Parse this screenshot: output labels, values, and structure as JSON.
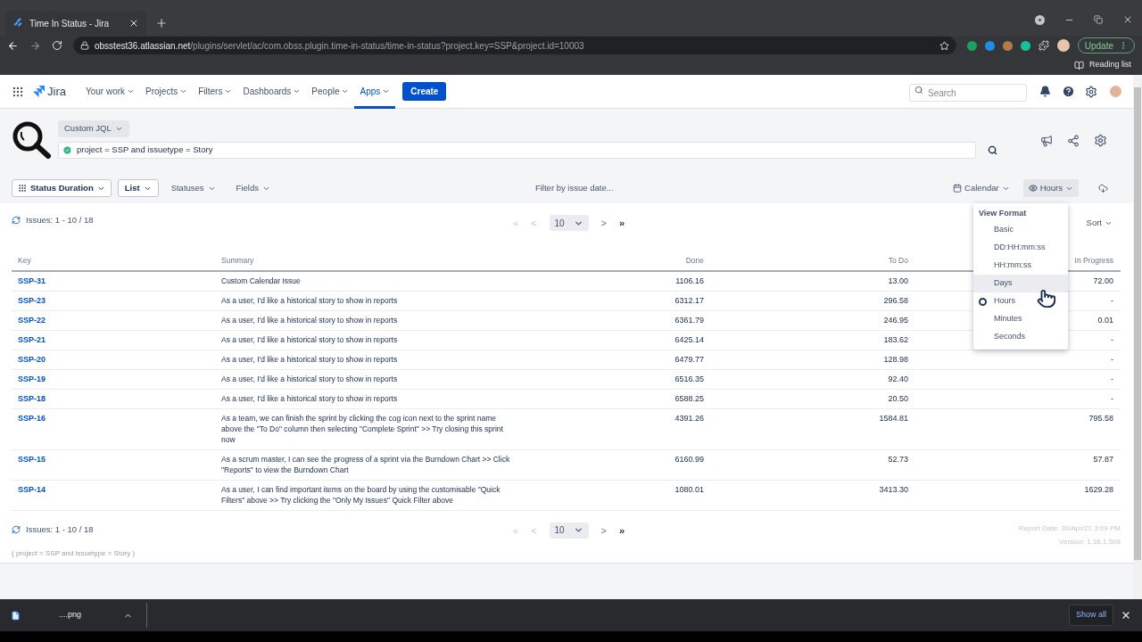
{
  "browser": {
    "tab_title": "Time In Status - Jira",
    "url_host": "obsstest36.atlassian.net",
    "url_path": "/plugins/servlet/ac/com.obss.plugin.time-in-status/time-in-status?project.key=SSP&project.id=10003",
    "update_label": "Update",
    "reading_list": "Reading list"
  },
  "nav": {
    "product": "Jira",
    "items": [
      {
        "label": "Your work",
        "selected": false
      },
      {
        "label": "Projects",
        "selected": false
      },
      {
        "label": "Filters",
        "selected": false
      },
      {
        "label": "Dashboards",
        "selected": false
      },
      {
        "label": "People",
        "selected": false
      },
      {
        "label": "Apps",
        "selected": true
      }
    ],
    "create": "Create",
    "search_placeholder": "Search"
  },
  "query": {
    "mode": "Custom JQL",
    "jql": "project = SSP and issuetype = Story",
    "valid": true
  },
  "toolbar": {
    "report": "Status Duration",
    "view": "List",
    "statuses": "Statuses",
    "fields": "Fields",
    "date_filter": "Filter by issue date...",
    "calendar": "Calendar",
    "format": "Hours"
  },
  "view_format_menu": {
    "title": "View Format",
    "options": [
      {
        "label": "Basic",
        "selected": false,
        "highlighted": false
      },
      {
        "label": "DD:HH:mm:ss",
        "selected": false,
        "highlighted": false
      },
      {
        "label": "HH:mm:ss",
        "selected": false,
        "highlighted": false
      },
      {
        "label": "Days",
        "selected": false,
        "highlighted": true
      },
      {
        "label": "Hours",
        "selected": true,
        "highlighted": false
      },
      {
        "label": "Minutes",
        "selected": false,
        "highlighted": false
      },
      {
        "label": "Seconds",
        "selected": false,
        "highlighted": false
      }
    ]
  },
  "top_bar": {
    "issues": "Issues: 1 - 10 / 18",
    "pager": [
      {
        "label": "«",
        "disabled": true
      },
      {
        "label": "<",
        "disabled": true
      },
      {
        "label": "10",
        "kind": "size"
      },
      {
        "label": ">",
        "disabled": false
      },
      {
        "label": "»",
        "disabled": false
      }
    ],
    "sort": "Sort"
  },
  "table": {
    "columns": [
      "Key",
      "Summary",
      "Done",
      "To Do",
      "In Progress"
    ],
    "rows": [
      {
        "key": "SSP-31",
        "summary": "Custom Calendar Issue",
        "done": "1106.16",
        "to_do": "13.00",
        "in_progress": "72.00"
      },
      {
        "key": "SSP-23",
        "summary": "As a user, I'd like a historical story to show in reports",
        "done": "6312.17",
        "to_do": "296.58",
        "in_progress": "-"
      },
      {
        "key": "SSP-22",
        "summary": "As a user, I'd like a historical story to show in reports",
        "done": "6361.79",
        "to_do": "246.95",
        "in_progress": "0.01"
      },
      {
        "key": "SSP-21",
        "summary": "As a user, I'd like a historical story to show in reports",
        "done": "6425.14",
        "to_do": "183.62",
        "in_progress": "-"
      },
      {
        "key": "SSP-20",
        "summary": "As a user, I'd like a historical story to show in reports",
        "done": "6479.77",
        "to_do": "128.98",
        "in_progress": "-"
      },
      {
        "key": "SSP-19",
        "summary": "As a user, I'd like a historical story to show in reports",
        "done": "6516.35",
        "to_do": "92.40",
        "in_progress": "-"
      },
      {
        "key": "SSP-18",
        "summary": "As a user, I'd like a historical story to show in reports",
        "done": "6588.25",
        "to_do": "20.50",
        "in_progress": "-"
      },
      {
        "key": "SSP-16",
        "summary": "As a team, we can finish the sprint by clicking the cog icon next to the sprint name above the \"To Do\" column then selecting \"Complete Sprint\" >> Try closing this sprint now",
        "done": "4391.26",
        "to_do": "1584.81",
        "in_progress": "795.58"
      },
      {
        "key": "SSP-15",
        "summary": "As a scrum master, I can see the progress of a sprint via the Burndown Chart >> Click \"Reports\" to view the Burndown Chart",
        "done": "6160.99",
        "to_do": "52.73",
        "in_progress": "57.87"
      },
      {
        "key": "SSP-14",
        "summary": "As a user, I can find important items on the board by using the customisable \"Quick Filters\" above >> Try clicking the \"Only My Issues\" Quick Filter above",
        "done": "1080.01",
        "to_do": "3413.30",
        "in_progress": "1629.28"
      }
    ]
  },
  "footer": {
    "issues": "Issues: 1 - 10 / 18",
    "pager": [
      {
        "label": "«",
        "disabled": true
      },
      {
        "label": "<",
        "disabled": true
      },
      {
        "label": "10",
        "kind": "size"
      },
      {
        "label": ">",
        "disabled": false
      },
      {
        "label": "»",
        "disabled": false
      }
    ],
    "jql_echo": "( project = SSP and issuetype = Story )",
    "report_date": "Report Date: 30/Apr/21 3:09 PM",
    "version": "Version: 1.36.1.508"
  },
  "downloads": {
    "file": "....png",
    "show_all": "Show all"
  }
}
